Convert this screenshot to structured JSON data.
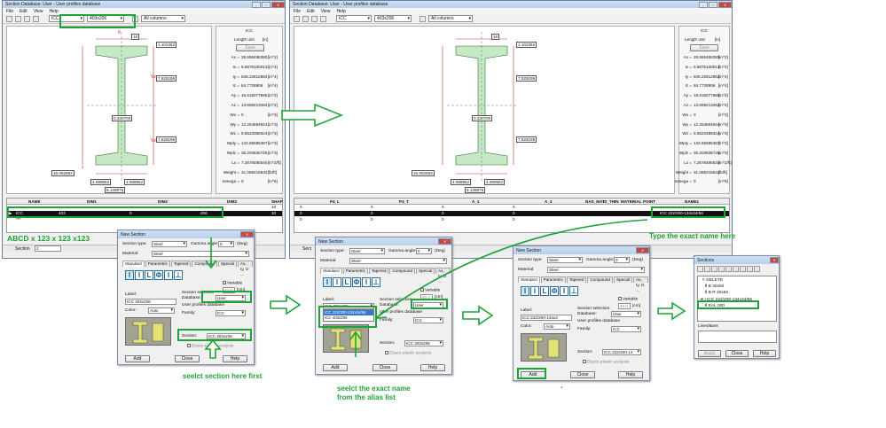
{
  "colors": {
    "annotation": "#1ea338",
    "shape_fill": "#c5e8c5",
    "selection": "#111111",
    "dim_red": "#d2302a"
  },
  "window": {
    "title": "Section Database: User - User profiles database",
    "menu": [
      "File",
      "Edit",
      "View",
      "Help"
    ],
    "toolbar_family": "ICC",
    "toolbar_section": "403x206",
    "toolbar_filter": "All columns",
    "dims": {
      "top_flange": "1.102362",
      "tf": "16",
      "web_h": "7.525196",
      "tw": "0.330700",
      "web_h2": "7.525196",
      "depth": "16.062993",
      "b1": "4.089552",
      "b2": "4.089552",
      "width": "8.139875"
    },
    "props": {
      "header": "ICC",
      "length_unit": "Length unit",
      "length_unit_val": "[in]",
      "save": "Save",
      "rows": [
        {
          "label": "Ax =",
          "value": "28.666486380",
          "unit": "[in^2]"
        },
        {
          "label": "Ix =",
          "value": "6.5875100013",
          "unit": "[in^4]"
        },
        {
          "label": "Iy =",
          "value": "845.22812862",
          "unit": "[in^4]"
        },
        {
          "label": "Iz =",
          "value": "84.7728906",
          "unit": "[in^4]"
        },
        {
          "label": "Ay =",
          "value": "18.615077685",
          "unit": "[in^2]"
        },
        {
          "label": "Az =",
          "value": "13.668213262",
          "unit": "[in^2]"
        },
        {
          "label": "Wx =",
          "value": "0",
          "unit": "[in^3]"
        },
        {
          "label": "Wy =",
          "value": "12.254684924",
          "unit": "[in^3]"
        },
        {
          "label": "Wz =",
          "value": "9.5523398324",
          "unit": "[in^3]"
        },
        {
          "label": "Wply =",
          "value": "142.65585387",
          "unit": "[in^3]"
        },
        {
          "label": "Wplz =",
          "value": "35.203935725",
          "unit": "[in^3]"
        },
        {
          "label": "Lx =",
          "value": "7.2678486540",
          "unit": "[in^2/ft]"
        },
        {
          "label": "Weight =",
          "value": "31.068215632",
          "unit": "[lb/ft]"
        },
        {
          "label": "Iomega =",
          "value": "0",
          "unit": "[in^6]"
        }
      ]
    },
    "grid_left": {
      "headers": [
        "NAME",
        "DIM1",
        "DIM2",
        "DIM3",
        "SHAP"
      ],
      "row_sel": [
        "ICC",
        "403",
        "0",
        "206",
        "10"
      ],
      "row_other": [
        "",
        "",
        "",
        "",
        "10"
      ],
      "row_new": [
        "***",
        "",
        "",
        "",
        ""
      ]
    },
    "grid_right": {
      "headers": [
        "P4_L",
        "P4_T",
        "A_1",
        "A_2",
        "NAS_MAT",
        "IS_THIN",
        "MATERIAL",
        "POINT",
        "NAME1"
      ],
      "row_sel": [
        "0",
        "0",
        "0",
        "0",
        "",
        "",
        "",
        "",
        "ICC 222/200-134x34/56"
      ],
      "row_other": [
        "0",
        "0",
        "0",
        "0",
        "",
        "",
        "",
        "",
        ""
      ]
    },
    "status_label": "Section",
    "status_value": "2",
    "status_label_right": "Sect"
  },
  "dialog": {
    "title": "New Section",
    "section_type_label": "Section type:",
    "section_type": "Steel",
    "gamma_label": "Gamma angle:",
    "gamma_value": "0",
    "gamma_unit": "(Deg)",
    "material_label": "Material:",
    "material": "Steel",
    "tabs": [
      "Standard",
      "Parametric",
      "Tapered",
      "Compound",
      "Special",
      "Ax, Iy, Iz ..."
    ],
    "shape_glyphs": [
      "I",
      "I",
      "L",
      "Φ",
      "I",
      "⊥"
    ],
    "variable": "Variable",
    "variable_val": "40.0",
    "variable_unit": "[cm]",
    "label_label": "Label:",
    "label_1": "ICC 403x206",
    "label_3": "ICC 222/200-134x3",
    "label_3_db": "ICC 222/200-134x34/56",
    "section_selection": "Section selection",
    "database_label": "Database:",
    "database": "User",
    "db_desc": "User profiles database",
    "family_label": "Family:",
    "family": "ICC",
    "section_label": "Section:",
    "section_1": "ICC 403x206",
    "section_3": "ICC 222/200-13",
    "color_label": "Color:",
    "color": "Auto",
    "elasto": "Elasto-plastic analysis",
    "alias_options": [
      "ICC 403x206",
      "ICC 222/200-134x34/56"
    ],
    "add": "Add",
    "close": "Close",
    "help": "Help"
  },
  "sections_dialog": {
    "title": "Sections",
    "items": [
      "DELETE",
      "B 30x50",
      "B R 30x50",
      "ICC 222/200-134x34/56",
      "EAL 000"
    ],
    "lines_label": "Lines/Bars",
    "apply": "Apply",
    "close": "Close",
    "help": "Help"
  },
  "annotations": {
    "abcd": "ABCD x 123 x 123 x123",
    "type_exact": "Type the exact name here",
    "select_first": "seelct section here first",
    "select_alias": "seelct the exact name\nfrom the alias list",
    "dot": "."
  }
}
